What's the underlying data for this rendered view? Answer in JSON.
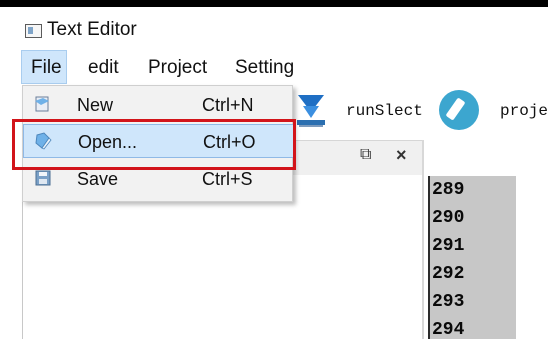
{
  "window": {
    "title": "Text Editor"
  },
  "menubar": {
    "items": [
      "File",
      "edit",
      "Project",
      "Setting"
    ]
  },
  "file_menu": {
    "items": [
      {
        "label": "New",
        "shortcut": "Ctrl+N",
        "icon": "new-file-icon"
      },
      {
        "label": "Open...",
        "shortcut": "Ctrl+O",
        "icon": "open-folder-icon",
        "highlighted": true
      },
      {
        "label": "Save",
        "shortcut": "Ctrl+S",
        "icon": "save-disk-icon"
      }
    ]
  },
  "toolbar": {
    "run_select_label": "runSlect",
    "project_label_partial": "proje"
  },
  "panel": {
    "float_icon": "⧉",
    "close_icon": "×"
  },
  "editor": {
    "line_numbers": [
      "289",
      "290",
      "291",
      "292",
      "293",
      "294"
    ]
  },
  "colors": {
    "highlight": "#cfe6fb",
    "annotation_red": "#d2141a",
    "gutter_gray": "#c7c7c7"
  }
}
